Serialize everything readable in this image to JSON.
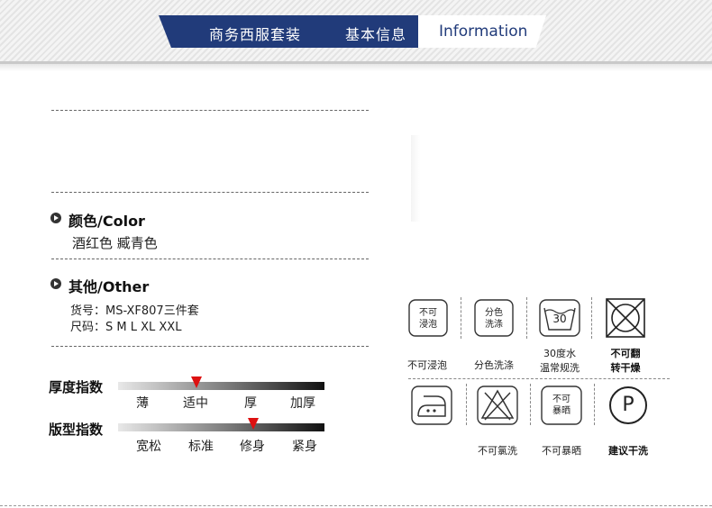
{
  "header": {
    "tab_product": "商务西服套装",
    "tab_info": "基本信息",
    "tab_en": "Information"
  },
  "color": {
    "title": "颜色/Color",
    "values": "酒红色  臧青色"
  },
  "other": {
    "title": "其他/Other",
    "item_no": "货号：MS-XF807三件套",
    "sizes": "尺码：S  M  L  XL  XXL"
  },
  "thickness": {
    "label": "厚度指数",
    "ticks": [
      "薄",
      "适中",
      "厚",
      "加厚"
    ],
    "selected": "适中"
  },
  "fit": {
    "label": "版型指数",
    "ticks": [
      "宽松",
      "标准",
      "修身",
      "紧身"
    ],
    "selected": "修身"
  },
  "care": {
    "items": [
      {
        "icon": "no-soak-icon",
        "icon_text": "不可浸泡",
        "label": "不可浸泡"
      },
      {
        "icon": "wash-separately-icon",
        "icon_text": "分色洗涤",
        "label": "分色洗涤"
      },
      {
        "icon": "wash-30-icon",
        "icon_text": "30",
        "label": "30度水温常规洗"
      },
      {
        "icon": "no-tumble-dry-icon",
        "icon_text": "",
        "label": "不可翻转干燥"
      },
      {
        "icon": "low-iron-icon",
        "icon_text": "",
        "label": ""
      },
      {
        "icon": "no-bleach-icon",
        "icon_text": "",
        "label": "不可氯洗"
      },
      {
        "icon": "no-sun-dry-icon",
        "icon_text": "不可暴晒",
        "label": "不可暴晒"
      },
      {
        "icon": "dry-clean-icon",
        "icon_text": "P",
        "label": "建议干洗"
      }
    ]
  }
}
